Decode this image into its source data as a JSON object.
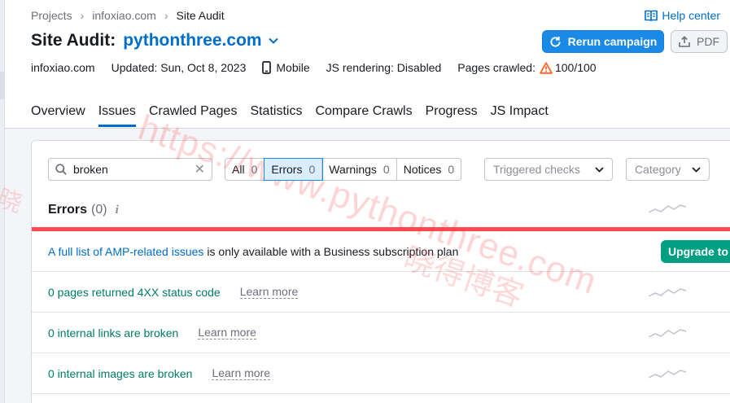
{
  "breadcrumb": {
    "items": [
      "Projects",
      "infoxiao.com",
      "Site Audit"
    ]
  },
  "help": {
    "label": "Help center",
    "icon": "book-icon"
  },
  "title": {
    "prefix": "Site Audit:",
    "project": "pythonthree.com"
  },
  "buttons": {
    "rerun": "Rerun campaign",
    "pdf": "PDF"
  },
  "meta": {
    "domain": "infoxiao.com",
    "updated": "Updated: Sun, Oct 8, 2023",
    "device": "Mobile",
    "js_rendering": "JS rendering: Disabled",
    "pages_crawled_label": "Pages crawled:",
    "pages_crawled_value": "100/100"
  },
  "tabs": [
    {
      "label": "Overview",
      "active": false
    },
    {
      "label": "Issues",
      "active": true
    },
    {
      "label": "Crawled Pages",
      "active": false
    },
    {
      "label": "Statistics",
      "active": false
    },
    {
      "label": "Compare Crawls",
      "active": false
    },
    {
      "label": "Progress",
      "active": false
    },
    {
      "label": "JS Impact",
      "active": false
    }
  ],
  "search": {
    "value": "broken",
    "clear": "✕"
  },
  "filters": [
    {
      "label": "All",
      "count": "0",
      "active": false
    },
    {
      "label": "Errors",
      "count": "0",
      "active": true
    },
    {
      "label": "Warnings",
      "count": "0",
      "active": false
    },
    {
      "label": "Notices",
      "count": "0",
      "active": false
    }
  ],
  "dropdowns": {
    "triggered": "Triggered checks",
    "category": "Category"
  },
  "section": {
    "title": "Errors",
    "count": "(0)",
    "info": "i"
  },
  "amp": {
    "link": "A full list of AMP-related issues",
    "text": "is only available with a Business subscription plan",
    "upgrade": "Upgrade to"
  },
  "issues": [
    {
      "text": "0 pages returned 4XX status code",
      "learn": "Learn more"
    },
    {
      "text": "0 internal links are broken",
      "learn": "Learn more"
    },
    {
      "text": "0 internal images are broken",
      "learn": "Learn more"
    }
  ],
  "watermark": {
    "url": "https://www.pythonthree.com",
    "cn": "晓得博客",
    "edge": "晓"
  },
  "colors": {
    "accent": "#006dca",
    "primary_button": "#1a8ae6",
    "error_bar": "#ff4953",
    "issue_text": "#007c65",
    "upgrade": "#009f81",
    "warning": "#ff642d"
  }
}
